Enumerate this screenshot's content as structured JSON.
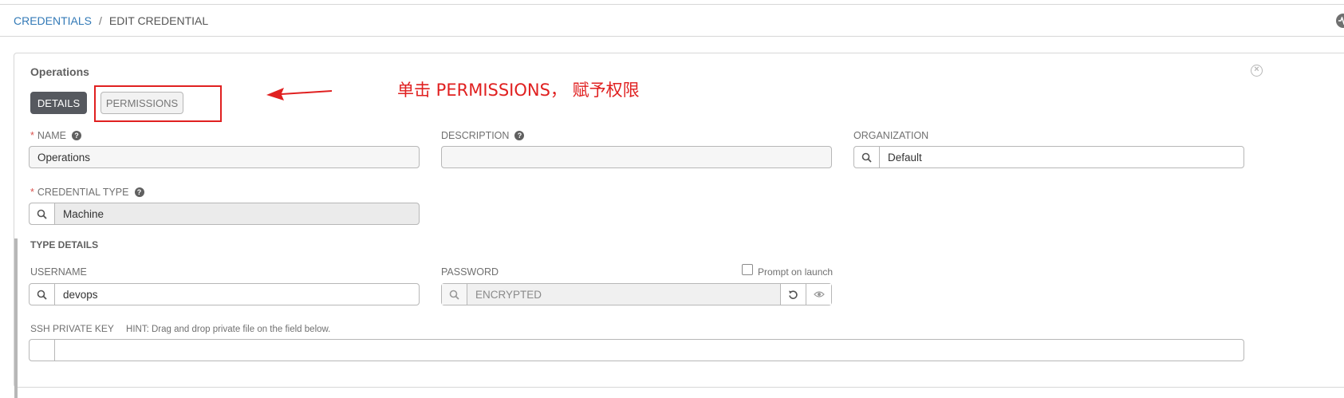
{
  "breadcrumb": {
    "link": "CREDENTIALS",
    "separator": "/",
    "current": "EDIT CREDENTIAL"
  },
  "panel": {
    "title": "Operations",
    "tabs": [
      {
        "label": "DETAILS",
        "active": true
      },
      {
        "label": "PERMISSIONS",
        "active": false
      }
    ]
  },
  "annotation": {
    "text": "单击 PERMISSIONS， 赋予权限",
    "color": "#e02020"
  },
  "form": {
    "name": {
      "label": "NAME",
      "required": "*",
      "value": "Operations"
    },
    "description": {
      "label": "DESCRIPTION",
      "value": ""
    },
    "organization": {
      "label": "ORGANIZATION",
      "value": "Default"
    },
    "credential_type": {
      "label": "CREDENTIAL TYPE",
      "required": "*",
      "value": "Machine"
    },
    "type_details_title": "TYPE DETAILS",
    "username": {
      "label": "USERNAME",
      "value": "devops"
    },
    "password": {
      "label": "PASSWORD",
      "value": "ENCRYPTED",
      "prompt_label": "Prompt on launch",
      "prompt_checked": false
    },
    "ssh_key": {
      "label": "SSH PRIVATE KEY",
      "hint": "HINT: Drag and drop private file on the field below."
    }
  },
  "icons": {
    "search": "search-icon",
    "help": "help-icon",
    "close": "close-icon",
    "revert": "revert-icon",
    "eye": "eye-icon",
    "activity": "activity-stream-icon"
  }
}
